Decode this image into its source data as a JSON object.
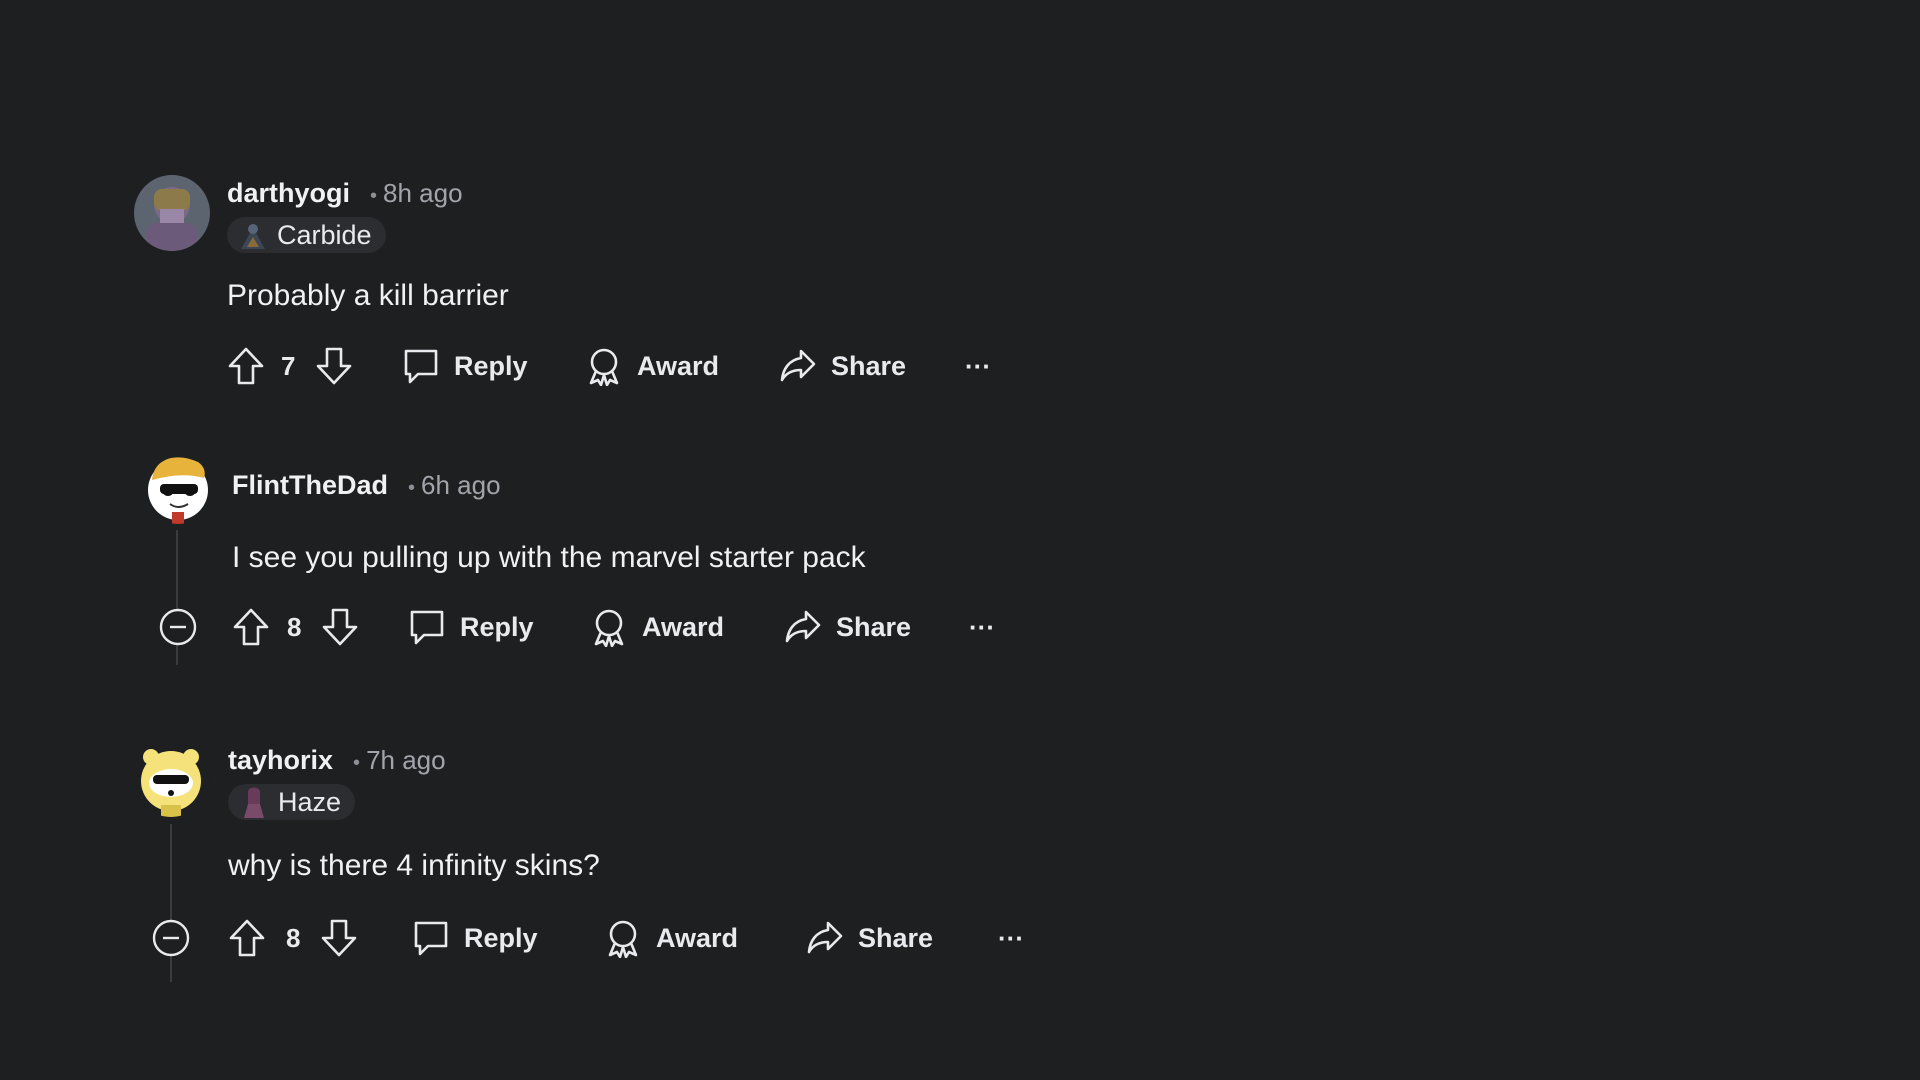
{
  "comments": [
    {
      "username": "darthyogi",
      "separator": "•",
      "time": "8h ago",
      "flair": "Carbide",
      "text": "Probably a kill barrier",
      "votes": "7",
      "reply_label": "Reply",
      "award_label": "Award",
      "share_label": "Share",
      "more_label": "···"
    },
    {
      "username": "FlintTheDad",
      "separator": "•",
      "time": "6h ago",
      "flair": "",
      "text": "I see you pulling up with the marvel starter pack",
      "votes": "8",
      "reply_label": "Reply",
      "award_label": "Award",
      "share_label": "Share",
      "more_label": "···"
    },
    {
      "username": "tayhorix",
      "separator": "•",
      "time": "7h ago",
      "flair": "Haze",
      "text": "why is there 4 infinity skins?",
      "votes": "8",
      "reply_label": "Reply",
      "award_label": "Award",
      "share_label": "Share",
      "more_label": "···"
    }
  ],
  "colors": {
    "background": "#1e1f21",
    "text": "#e8eaed",
    "muted": "#a1a5ab",
    "flair_bg": "#2b2d30"
  }
}
